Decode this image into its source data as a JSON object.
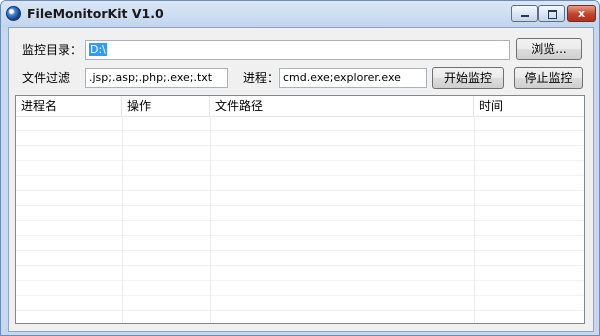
{
  "window": {
    "title": "FileMonitorKit V1.0",
    "controls": {
      "minimize": "",
      "maximize": "",
      "close": "x"
    }
  },
  "form": {
    "dir_label": "监控目录：",
    "dir_value": "D:\\",
    "browse_label": "浏览...",
    "filter_label": "文件过滤",
    "filter_value": ".jsp;.asp;.php;.exe;.txt",
    "process_label": "进程：",
    "process_value": "cmd.exe;explorer.exe",
    "start_label": "开始监控",
    "stop_label": "停止监控"
  },
  "table": {
    "columns": [
      "进程名",
      "操作",
      "文件路径",
      "时间"
    ],
    "rows": []
  },
  "colors": {
    "title_bar": "#c7d8ee",
    "selection": "#3399ff",
    "close_button": "#c1432b"
  },
  "icons": {
    "app": "filemonitor-globe-icon",
    "minimize": "minimize-icon",
    "maximize": "maximize-icon",
    "close": "close-icon"
  }
}
